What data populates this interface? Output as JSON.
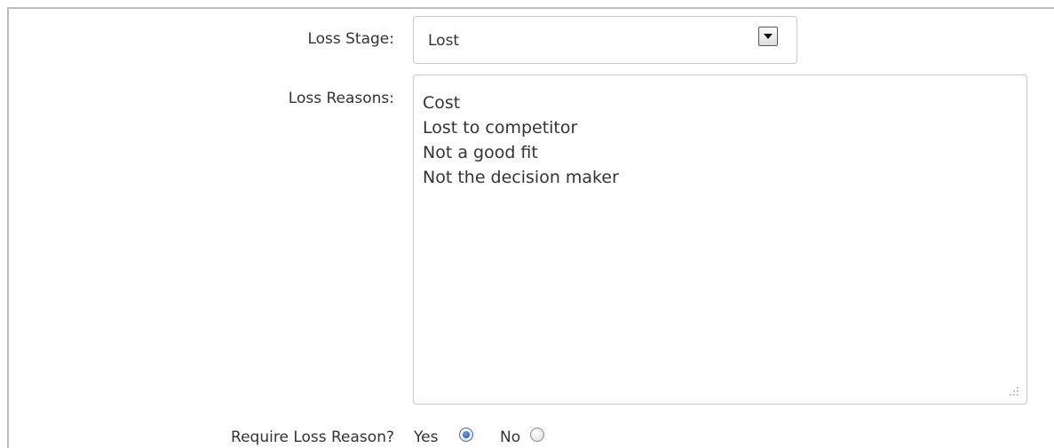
{
  "form": {
    "loss_stage": {
      "label": "Loss Stage:",
      "selected": "Lost"
    },
    "loss_reasons": {
      "label": "Loss Reasons:",
      "items": [
        "Cost",
        "Lost to competitor",
        "Not a good fit",
        "Not the decision maker"
      ]
    },
    "require_loss_reason": {
      "label": "Require Loss Reason?",
      "options": [
        "Yes",
        "No"
      ],
      "selected": "Yes"
    }
  },
  "icons": {
    "dropdown": "chevron-down-icon",
    "resize": "resize-grip-icon"
  },
  "colors": {
    "text": "#333333",
    "border": "#c8c8c8",
    "radio_selected": "#1d4f9a"
  }
}
